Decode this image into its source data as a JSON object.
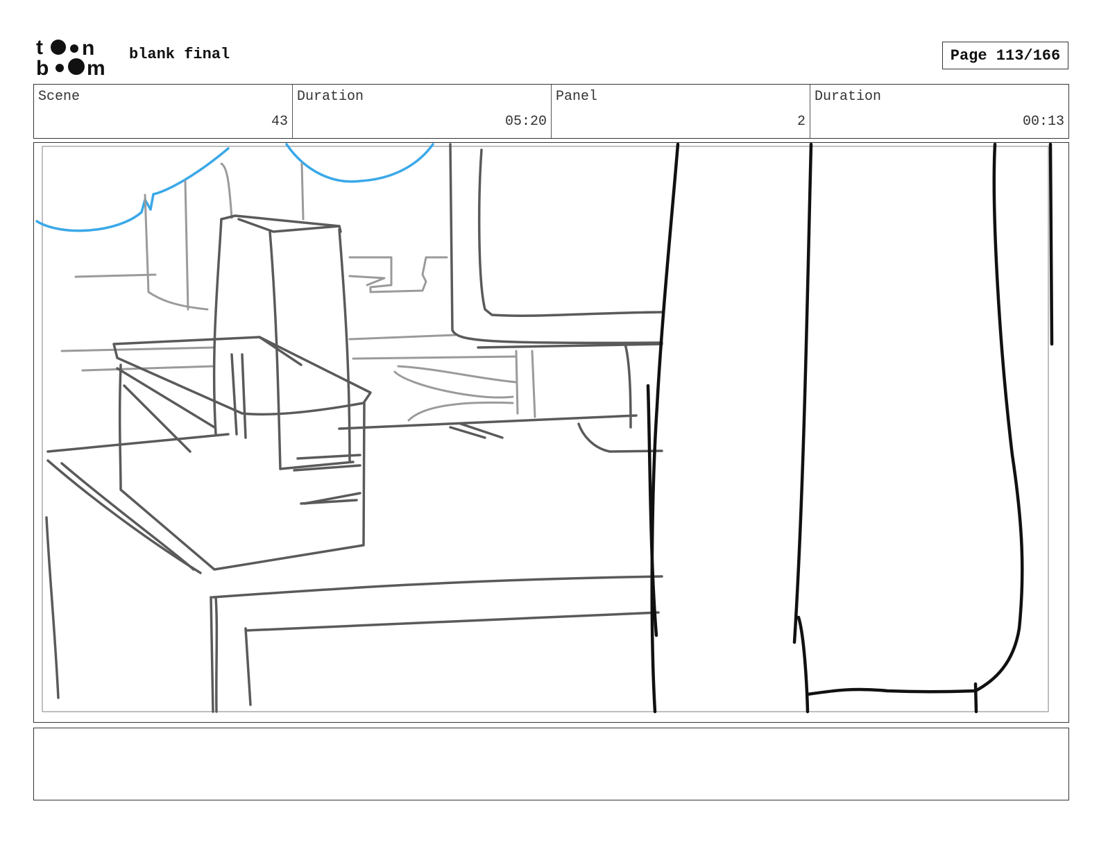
{
  "header": {
    "logo_text": "toon boom",
    "project_title": "blank final",
    "page_label": "Page 113/166"
  },
  "info": {
    "scene_label": "Scene",
    "scene_value": "43",
    "scene_duration_label": "Duration",
    "scene_duration_value": "05:20",
    "panel_label": "Panel",
    "panel_value": "2",
    "panel_duration_label": "Duration",
    "panel_duration_value": "00:13"
  },
  "notes": {
    "text": ""
  },
  "colors": {
    "sky_line": "#3aa8e8",
    "sketch_light": "#9a9a9a",
    "sketch_mid": "#5a5a5a",
    "sketch_dark": "#111111"
  }
}
